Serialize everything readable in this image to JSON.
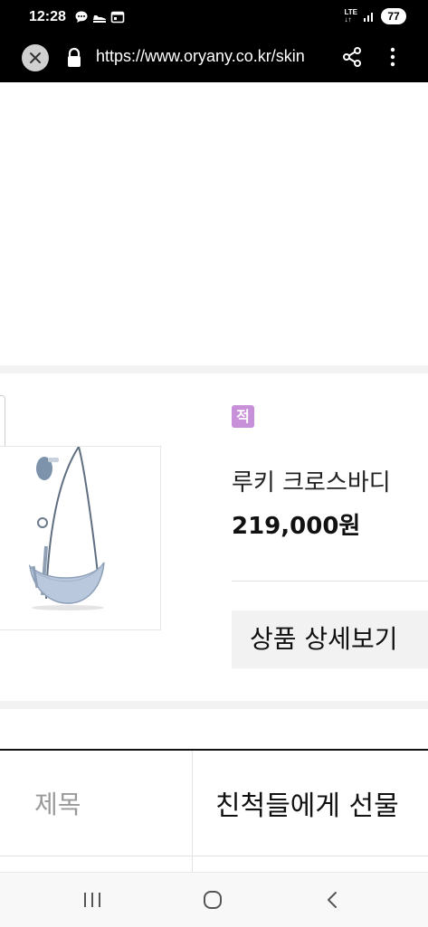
{
  "status_bar": {
    "time": "12:28",
    "network": "LTE",
    "battery": "77"
  },
  "browser": {
    "url": "https://www.oryany.co.kr/skin"
  },
  "product": {
    "badge": "적",
    "name": "루키 크로스바디",
    "price": "219,000원",
    "detail_button_label": "상품 상세보기"
  },
  "table": {
    "title_label": "제목",
    "title_value": "친척들에게 선물"
  },
  "colors": {
    "badge": "#c890d8",
    "bag": "#b9c8dc"
  }
}
